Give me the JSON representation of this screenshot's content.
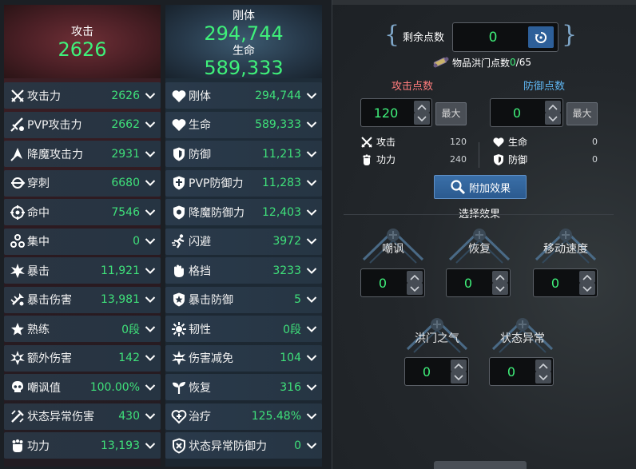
{
  "attack_column": {
    "header_label": "攻击",
    "header_value": "2626",
    "rows": [
      {
        "icon": "crossed-swords-icon",
        "label": "攻击力",
        "value": "2626"
      },
      {
        "icon": "sword-pvp-icon",
        "label": "PVP攻击力",
        "value": "2662"
      },
      {
        "icon": "demon-attack-icon",
        "label": "降魔攻击力",
        "value": "2931"
      },
      {
        "icon": "pierce-icon",
        "label": "穿刺",
        "value": "6680"
      },
      {
        "icon": "crosshair-icon",
        "label": "命中",
        "value": "7546"
      },
      {
        "icon": "focus-icon",
        "label": "集中",
        "value": "0"
      },
      {
        "icon": "burst-icon",
        "label": "暴击",
        "value": "11,921"
      },
      {
        "icon": "crit-damage-icon",
        "label": "暴击伤害",
        "value": "13,981"
      },
      {
        "icon": "star-icon",
        "label": "熟练",
        "value": "0段"
      },
      {
        "icon": "extra-damage-icon",
        "label": "额外伤害",
        "value": "142"
      },
      {
        "icon": "skull-icon",
        "label": "嘲讽值",
        "value": "100.00%"
      },
      {
        "icon": "status-damage-icon",
        "label": "状态异常伤害",
        "value": "430"
      },
      {
        "icon": "fist-icon",
        "label": "功力",
        "value": "13,193"
      }
    ]
  },
  "defense_column": {
    "header_label": "刚体",
    "header_value": "294,744",
    "header_label2": "生命",
    "header_value2": "589,333",
    "rows": [
      {
        "icon": "heart-icon",
        "label": "刚体",
        "value": "294,744"
      },
      {
        "icon": "heart-icon",
        "label": "生命",
        "value": "589,333"
      },
      {
        "icon": "shield-icon",
        "label": "防御",
        "value": "11,213"
      },
      {
        "icon": "shield-pvp-icon",
        "label": "PVP防御力",
        "value": "11,283"
      },
      {
        "icon": "demon-defense-icon",
        "label": "降魔防御力",
        "value": "12,403"
      },
      {
        "icon": "dodge-icon",
        "label": "闪避",
        "value": "3972"
      },
      {
        "icon": "block-icon",
        "label": "格挡",
        "value": "3233"
      },
      {
        "icon": "crit-defense-icon",
        "label": "暴击防御",
        "value": "5"
      },
      {
        "icon": "toughness-icon",
        "label": "韧性",
        "value": "0段"
      },
      {
        "icon": "damage-reduce-icon",
        "label": "伤害减免",
        "value": "104"
      },
      {
        "icon": "sprout-icon",
        "label": "恢复",
        "value": "316"
      },
      {
        "icon": "heal-icon",
        "label": "治疗",
        "value": "125.48%"
      },
      {
        "icon": "status-defense-icon",
        "label": "状态异常防御力",
        "value": "0"
      }
    ]
  },
  "points_panel": {
    "remaining_label": "剩余点数",
    "remaining_value": "0",
    "item_points_label": "物品洪门点数",
    "item_points_current": "0",
    "item_points_total": "/65",
    "attack_points_label": "攻击点数",
    "defense_points_label": "防御点数",
    "attack_points_value": "120",
    "defense_points_value": "0",
    "max_label": "最大",
    "attack_bonus": [
      {
        "icon": "crossed-swords-icon",
        "label": "攻击",
        "value": "120"
      },
      {
        "icon": "fist-icon",
        "label": "功力",
        "value": "240"
      }
    ],
    "defense_bonus": [
      {
        "icon": "heart-icon",
        "label": "生命",
        "value": "0"
      },
      {
        "icon": "shield-icon",
        "label": "防御",
        "value": "0"
      }
    ],
    "add_effect_label": "附加效果",
    "select_effect_title": "选择效果",
    "effects": [
      {
        "label": "嘲讽",
        "value": "0"
      },
      {
        "label": "恢复",
        "value": "0"
      },
      {
        "label": "移动速度",
        "value": "0"
      },
      {
        "label": "洪门之气",
        "value": "0"
      },
      {
        "label": "状态异常",
        "value": "0"
      }
    ]
  },
  "colors": {
    "value_green": "#3fe07a",
    "attack_points_color": "#ff7c7c",
    "defense_points_color": "#5fb6f2",
    "button_blue": "#2d5f99"
  }
}
